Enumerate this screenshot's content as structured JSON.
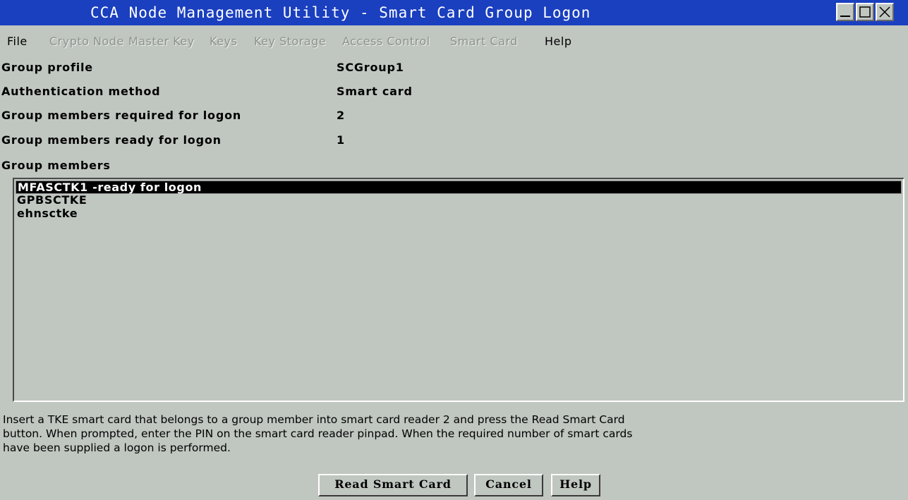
{
  "window": {
    "title": "CCA Node Management Utility  -  Smart Card Group Logon",
    "controls": [
      "minimize-icon",
      "maximize-icon",
      "close-icon"
    ],
    "title_bar_color": "#1a3fbf"
  },
  "menu": {
    "items": [
      {
        "label": "File",
        "enabled": true
      },
      {
        "label": "Crypto Node",
        "enabled": false
      },
      {
        "label": "Master Key",
        "enabled": false
      },
      {
        "label": "Keys",
        "enabled": false
      },
      {
        "label": "Key Storage",
        "enabled": false
      },
      {
        "label": "Access Control",
        "enabled": false
      },
      {
        "label": "Smart Card",
        "enabled": false
      },
      {
        "label": "Help",
        "enabled": true
      }
    ]
  },
  "properties": {
    "group_profile": {
      "label": "Group profile",
      "value": "SCGroup1"
    },
    "auth_method": {
      "label": "Authentication method",
      "value": "Smart card"
    },
    "members_required": {
      "label": "Group members required for logon",
      "value": "2"
    },
    "members_ready": {
      "label": "Group members ready for logon",
      "value": "1"
    }
  },
  "members": {
    "label": "Group members",
    "items": [
      {
        "text": "MFASCTK1 -ready for logon",
        "selected": true
      },
      {
        "text": "GPBSCTKE",
        "selected": false
      },
      {
        "text": "ehnsctke",
        "selected": false
      }
    ]
  },
  "instructions": {
    "line1": "Insert a TKE smart card that belongs to a group member into smart card reader 2 and press the Read Smart Card",
    "line2": "button.  When prompted, enter the PIN on the smart card reader pinpad. When the required number of smart cards",
    "line3": "have been supplied a logon is performed."
  },
  "buttons": {
    "read": "Read Smart Card",
    "cancel": "Cancel",
    "help": "Help"
  }
}
